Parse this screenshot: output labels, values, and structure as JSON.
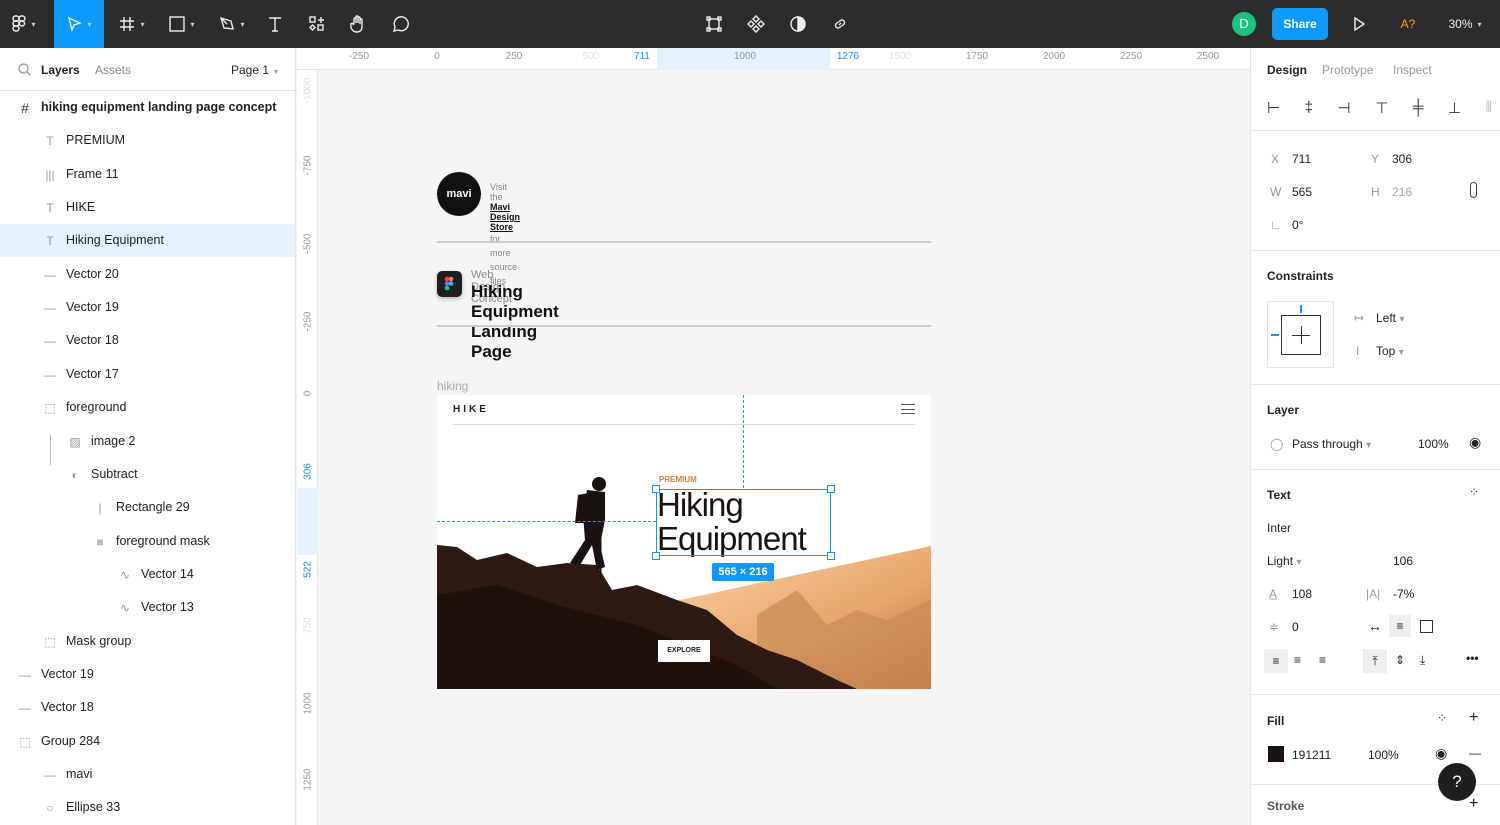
{
  "toolbar": {
    "avatar_initial": "D",
    "share_label": "Share",
    "font_warning": "A?",
    "zoom": "30%"
  },
  "left_panel": {
    "tabs": [
      "Layers",
      "Assets"
    ],
    "page": "Page 1",
    "layers": [
      {
        "label": "hiking equipment landing page concept",
        "icon": "frame-icon",
        "level": 0,
        "bold": true
      },
      {
        "label": "PREMIUM",
        "icon": "text-icon",
        "level": 1
      },
      {
        "label": "Frame 11",
        "icon": "auto-layout-icon",
        "level": 1
      },
      {
        "label": "HIKE",
        "icon": "text-icon",
        "level": 1
      },
      {
        "label": "Hiking Equipment",
        "icon": "text-icon",
        "level": 1,
        "selected": true
      },
      {
        "label": "Vector 20",
        "icon": "line-icon",
        "level": 1
      },
      {
        "label": "Vector 19",
        "icon": "line-icon",
        "level": 1
      },
      {
        "label": "Vector 18",
        "icon": "line-icon",
        "level": 1
      },
      {
        "label": "Vector 17",
        "icon": "line-icon",
        "level": 1
      },
      {
        "label": "foreground",
        "icon": "group-icon",
        "level": 1
      },
      {
        "label": "image 2",
        "icon": "image-icon",
        "level": 2
      },
      {
        "label": "Subtract",
        "icon": "boolean-icon",
        "level": 2
      },
      {
        "label": "Rectangle 29",
        "icon": "rectangle-icon",
        "level": 3
      },
      {
        "label": "foreground mask",
        "icon": "mask-icon",
        "level": 3
      },
      {
        "label": "Vector 14",
        "icon": "vector-icon",
        "level": 4
      },
      {
        "label": "Vector 13",
        "icon": "vector-icon",
        "level": 4
      },
      {
        "label": "Mask group",
        "icon": "group-icon",
        "level": 1
      },
      {
        "label": "Vector 19",
        "icon": "line-icon",
        "level": 0
      },
      {
        "label": "Vector 18",
        "icon": "line-icon",
        "level": 0
      },
      {
        "label": "Group 284",
        "icon": "group-icon",
        "level": 0
      },
      {
        "label": "mavi",
        "icon": "line-icon",
        "level": 1
      },
      {
        "label": "Ellipse 33",
        "icon": "ellipse-icon",
        "level": 1
      }
    ]
  },
  "rulers": {
    "h": [
      "-250",
      "0",
      "250",
      "500",
      "711",
      "1000",
      "1276",
      "1500",
      "1750",
      "2000",
      "2250",
      "2500"
    ],
    "v": [
      "-1000",
      "-750",
      "-500",
      "-250",
      "0",
      "306",
      "522",
      "750",
      "1000",
      "1250"
    ]
  },
  "canvas": {
    "mavi_logo": "mavi",
    "visit_prefix": "Visit the",
    "store_link": "Mavi Design Store",
    "visit_suffix": "for more source files",
    "concept_sub": "Web Design Concept",
    "concept_title": "Hiking Equipment Landing Page",
    "frame_label": "hiking equipment landing page concept",
    "hike_logo": "HIKE",
    "premium": "PREMIUM",
    "headline_1": "Hiking",
    "headline_2": "Equipment",
    "size_badge": "565 × 216",
    "explore": "EXPLORE"
  },
  "right_panel": {
    "tabs": [
      "Design",
      "Prototype",
      "Inspect"
    ],
    "x": "711",
    "y": "306",
    "w": "565",
    "h": "216",
    "rotation": "0°",
    "constraints_title": "Constraints",
    "constraint_h": "Left",
    "constraint_v": "Top",
    "layer_title": "Layer",
    "blend": "Pass through",
    "opacity": "100%",
    "text_title": "Text",
    "font": "Inter",
    "weight": "Light",
    "size": "106",
    "line_height": "108",
    "letter_spacing": "-7%",
    "paragraph_spacing": "0",
    "fill_title": "Fill",
    "fill_hex": "191211",
    "fill_opacity": "100%",
    "fill_color": "#191211",
    "stroke_title": "Stroke",
    "help": "?"
  }
}
